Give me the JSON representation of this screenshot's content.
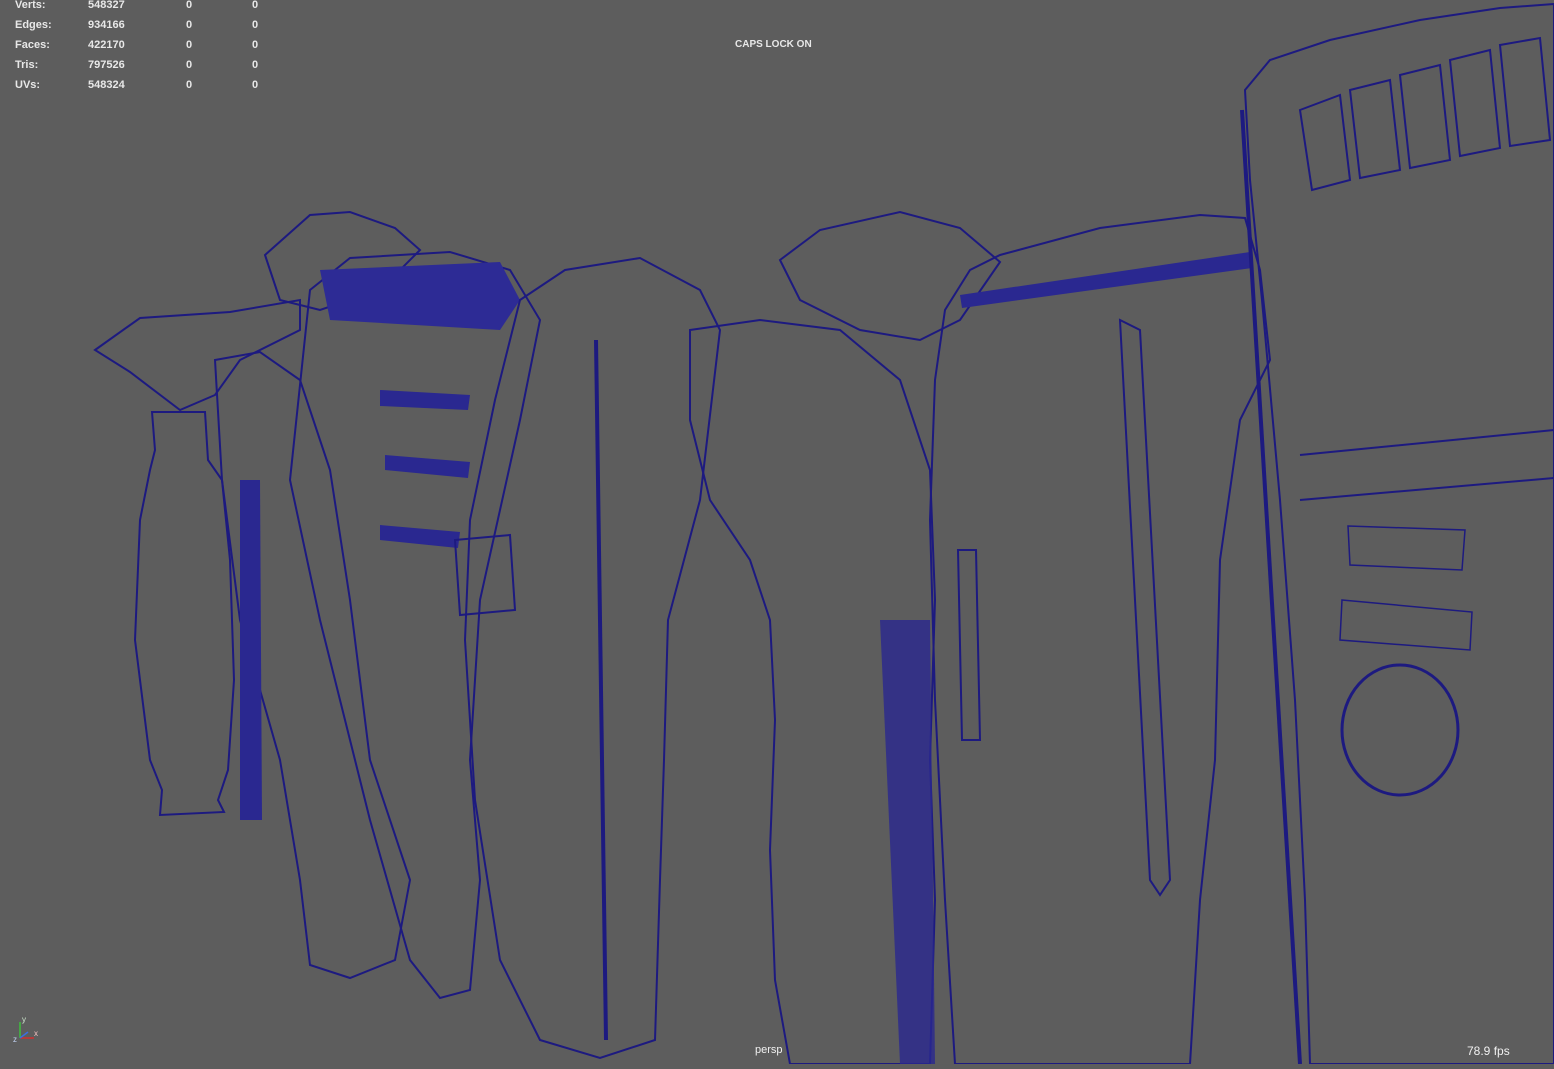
{
  "hud": {
    "rows": [
      {
        "label": "Verts:",
        "total": "548327",
        "selected": "0",
        "component": "0"
      },
      {
        "label": "Edges:",
        "total": "934166",
        "selected": "0",
        "component": "0"
      },
      {
        "label": "Faces:",
        "total": "422170",
        "selected": "0",
        "component": "0"
      },
      {
        "label": "Tris:",
        "total": "797526",
        "selected": "0",
        "component": "0"
      },
      {
        "label": "UVs:",
        "total": "548324",
        "selected": "0",
        "component": "0"
      }
    ]
  },
  "status": {
    "caps_lock": "CAPS LOCK ON"
  },
  "viewport": {
    "camera": "persp",
    "fps": "78.9 fps",
    "background": "#5d5d5d",
    "wire_color": "#1d1a80",
    "surface_color": "#a7a7a7"
  },
  "axis": {
    "x": "x",
    "y": "y",
    "z": "z"
  }
}
